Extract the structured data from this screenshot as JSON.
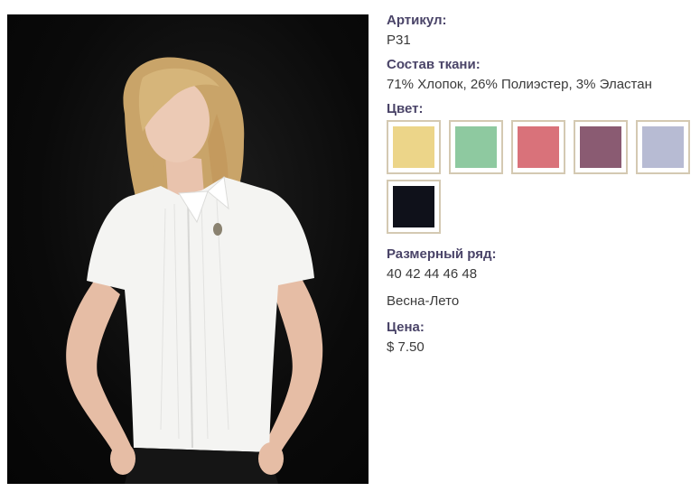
{
  "product": {
    "sku_label": "Артикул:",
    "sku": "P31",
    "fabric_label": "Состав ткани:",
    "fabric": "71% Хлопок, 26% Полиэстер, 3% Эластан",
    "color_label": "Цвет:",
    "colors": [
      {
        "name": "yellow-swatch",
        "hex": "#ecd589"
      },
      {
        "name": "green-swatch",
        "hex": "#8ec9a0"
      },
      {
        "name": "pink-swatch",
        "hex": "#d9727a"
      },
      {
        "name": "plum-swatch",
        "hex": "#8a5b72"
      },
      {
        "name": "lavender-swatch",
        "hex": "#b7bbd3"
      },
      {
        "name": "black-swatch",
        "hex": "#0f111a"
      }
    ],
    "sizes_label": "Размерный ряд:",
    "sizes": "40 42 44 46 48",
    "season": "Весна-Лето",
    "price_label": "Цена:",
    "price": "$ 7.50"
  },
  "colors": {
    "label_text": "#4a4468",
    "body_text": "#3a3a3a",
    "swatch_border": "#d4c9b2",
    "photo_background": "#0a0a0a"
  }
}
